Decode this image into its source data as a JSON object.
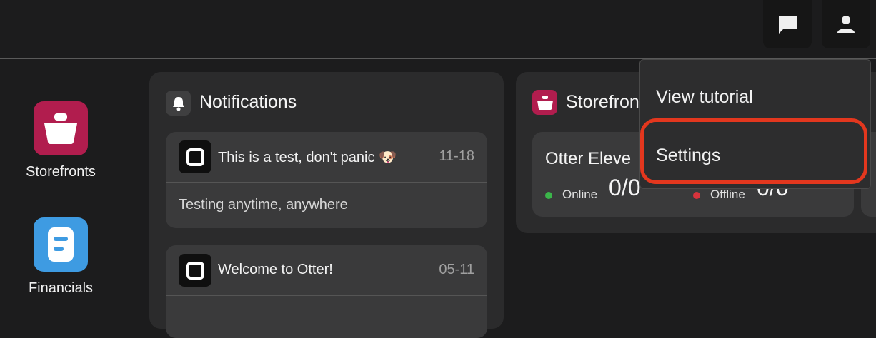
{
  "colors": {
    "background": "#1c1c1d",
    "panel": "#2b2b2c",
    "card": "#3a3a3b",
    "storefronts_brand": "#b11d4e",
    "financials_brand": "#3e9be2",
    "online": "#3bb54a",
    "offline": "#d7333c",
    "highlight": "#e3371e"
  },
  "topbar": {
    "icons": [
      "chat-icon",
      "user-icon"
    ]
  },
  "sidebar": {
    "items": [
      {
        "label": "Storefronts",
        "icon": "storefront-bag-icon"
      },
      {
        "label": "Financials",
        "icon": "financials-doc-icon"
      }
    ]
  },
  "notifications": {
    "title": "Notifications",
    "icon": "bell-icon",
    "items": [
      {
        "title": "This is a test, don't panic 🐶",
        "date": "11-18",
        "body": "Testing anytime, anywhere"
      },
      {
        "title": "Welcome to Otter!",
        "date": "05-11",
        "body": ""
      }
    ]
  },
  "storefronts": {
    "title": "Storefron",
    "card": {
      "name": "Otter Eleve",
      "online_label": "Online",
      "online_count": "0/0",
      "offline_label": "Offline",
      "offline_count": "0/0"
    }
  },
  "menu": {
    "items": [
      {
        "label": "View tutorial"
      },
      {
        "label": "Settings"
      }
    ]
  }
}
